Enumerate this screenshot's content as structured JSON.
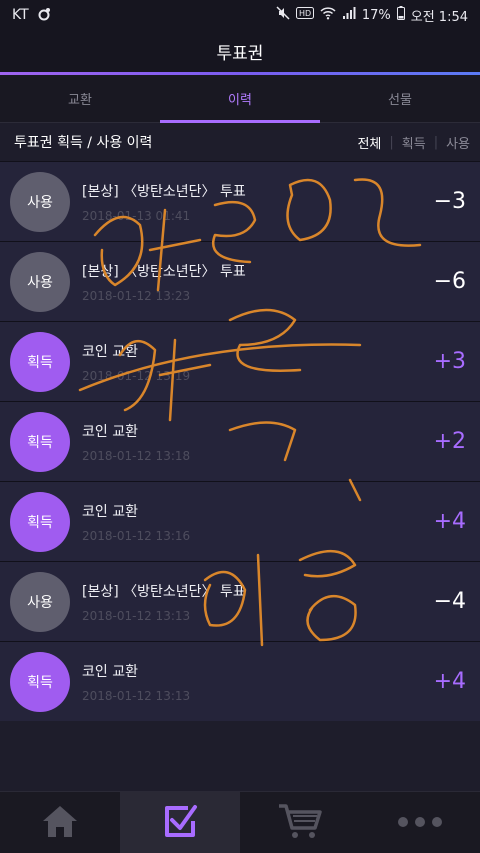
{
  "status": {
    "carrier": "KT",
    "battery": "17%",
    "time": "오전 1:54"
  },
  "title": "투표권",
  "tabs": [
    {
      "label": "교환",
      "active": false
    },
    {
      "label": "이력",
      "active": true
    },
    {
      "label": "선물",
      "active": false
    }
  ],
  "section": {
    "title": "투표권 획득 / 사용 이력",
    "filters": [
      "전체",
      "획득",
      "사용"
    ],
    "selected_filter": "전체"
  },
  "history": [
    {
      "type": "use",
      "badge": "사용",
      "label": "[본상] 〈방탄소년단〉 투표",
      "date": "2018-01-13 01:41",
      "amount": "−3"
    },
    {
      "type": "use",
      "badge": "사용",
      "label": "[본상] 〈방탄소년단〉 투표",
      "date": "2018-01-12 13:23",
      "amount": "−6"
    },
    {
      "type": "gain",
      "badge": "획득",
      "label": "코인 교환",
      "date": "2018-01-12 13:19",
      "amount": "+3"
    },
    {
      "type": "gain",
      "badge": "획득",
      "label": "코인 교환",
      "date": "2018-01-12 13:18",
      "amount": "+2"
    },
    {
      "type": "gain",
      "badge": "획득",
      "label": "코인 교환",
      "date": "2018-01-12 13:16",
      "amount": "+4"
    },
    {
      "type": "use",
      "badge": "사용",
      "label": "[본상] 〈방탄소년단〉 투표",
      "date": "2018-01-12 13:13",
      "amount": "−4"
    },
    {
      "type": "gain",
      "badge": "획득",
      "label": "코인 교환",
      "date": "2018-01-12 13:13",
      "amount": "+4"
    }
  ],
  "bottom_nav": [
    {
      "icon": "home-icon",
      "active": false
    },
    {
      "icon": "vote-check-icon",
      "active": true
    },
    {
      "icon": "cart-icon",
      "active": false
    },
    {
      "icon": "more-icon",
      "active": false
    }
  ],
  "colors": {
    "accent": "#a86cff",
    "background": "#1e1d2b",
    "row": "#25243a",
    "scribble": "#d9862b"
  }
}
